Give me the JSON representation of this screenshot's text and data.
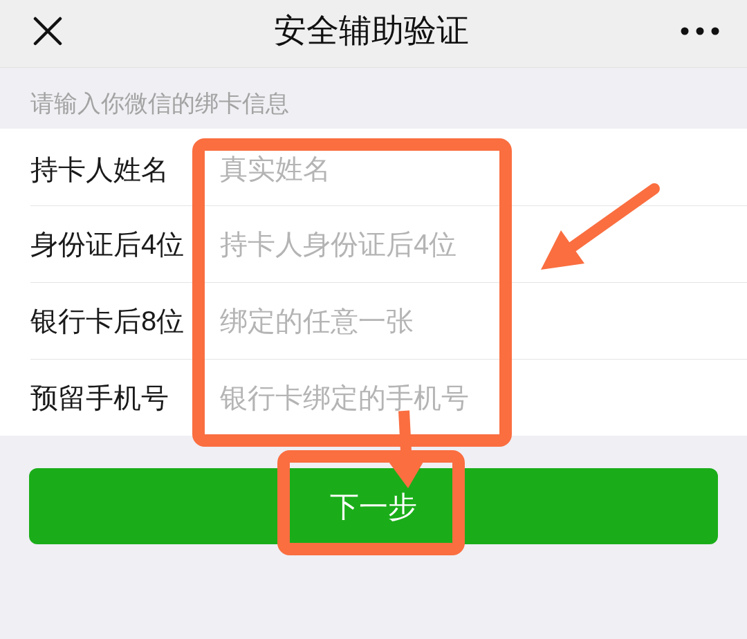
{
  "header": {
    "title": "安全辅助验证"
  },
  "hint": "请输入你微信的绑卡信息",
  "fields": [
    {
      "label": "持卡人姓名",
      "placeholder": "真实姓名"
    },
    {
      "label": "身份证后4位",
      "placeholder": "持卡人身份证后4位"
    },
    {
      "label": "银行卡后8位",
      "placeholder": "绑定的任意一张"
    },
    {
      "label": "预留手机号",
      "placeholder": "银行卡绑定的手机号"
    }
  ],
  "next_button": {
    "label": "下一步"
  }
}
